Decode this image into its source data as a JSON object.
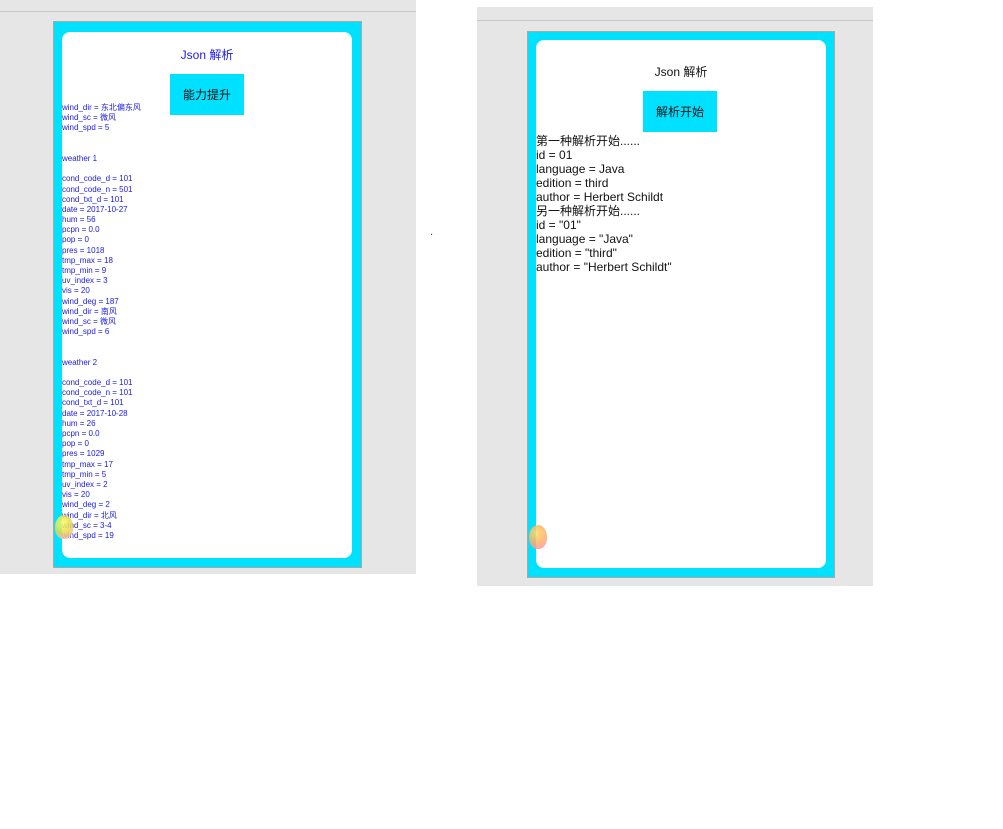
{
  "left": {
    "title": "Json 解析",
    "button_label": "能力提升",
    "log_lines": [
      "wind_dir = 东北偏东风",
      "wind_sc = 微风",
      "wind_spd = 5",
      "",
      "",
      "weather 1",
      "",
      "cond_code_d = 101",
      "cond_code_n = 501",
      "cond_txt_d = 101",
      "date = 2017-10-27",
      "hum = 56",
      "pcpn = 0.0",
      "pop = 0",
      "pres = 1018",
      "tmp_max = 18",
      "tmp_min = 9",
      "uv_index = 3",
      "vis = 20",
      "wind_deg = 187",
      "wind_dir = 南风",
      "wind_sc = 微风",
      "wind_spd = 6",
      "",
      "",
      "weather 2",
      "",
      "cond_code_d = 101",
      "cond_code_n = 101",
      "cond_txt_d = 101",
      "date = 2017-10-28",
      "hum = 26",
      "pcpn = 0.0",
      "pop = 0",
      "pres = 1029",
      "tmp_max = 17",
      "tmp_min = 5",
      "uv_index = 2",
      "vis = 20",
      "wind_deg = 2",
      "wind_dir = 北风",
      "wind_sc = 3-4",
      "wind_spd = 19"
    ]
  },
  "right": {
    "title": "Json 解析",
    "button_label": "解析开始",
    "log_lines": [
      "第一种解析开始......",
      "id = 01",
      "language = Java",
      "edition = third",
      "author = Herbert Schildt",
      "另一种解析开始......",
      "id = \"01\"",
      "language = \"Java\"",
      "edition = \"third\"",
      "author = \"Herbert Schildt\""
    ]
  },
  "separator_text": ".",
  "colors": {
    "accent": "#00e1ff",
    "left_text": "#1a1ae6",
    "right_text": "#111111",
    "background_panel": "#e6e6e6"
  }
}
